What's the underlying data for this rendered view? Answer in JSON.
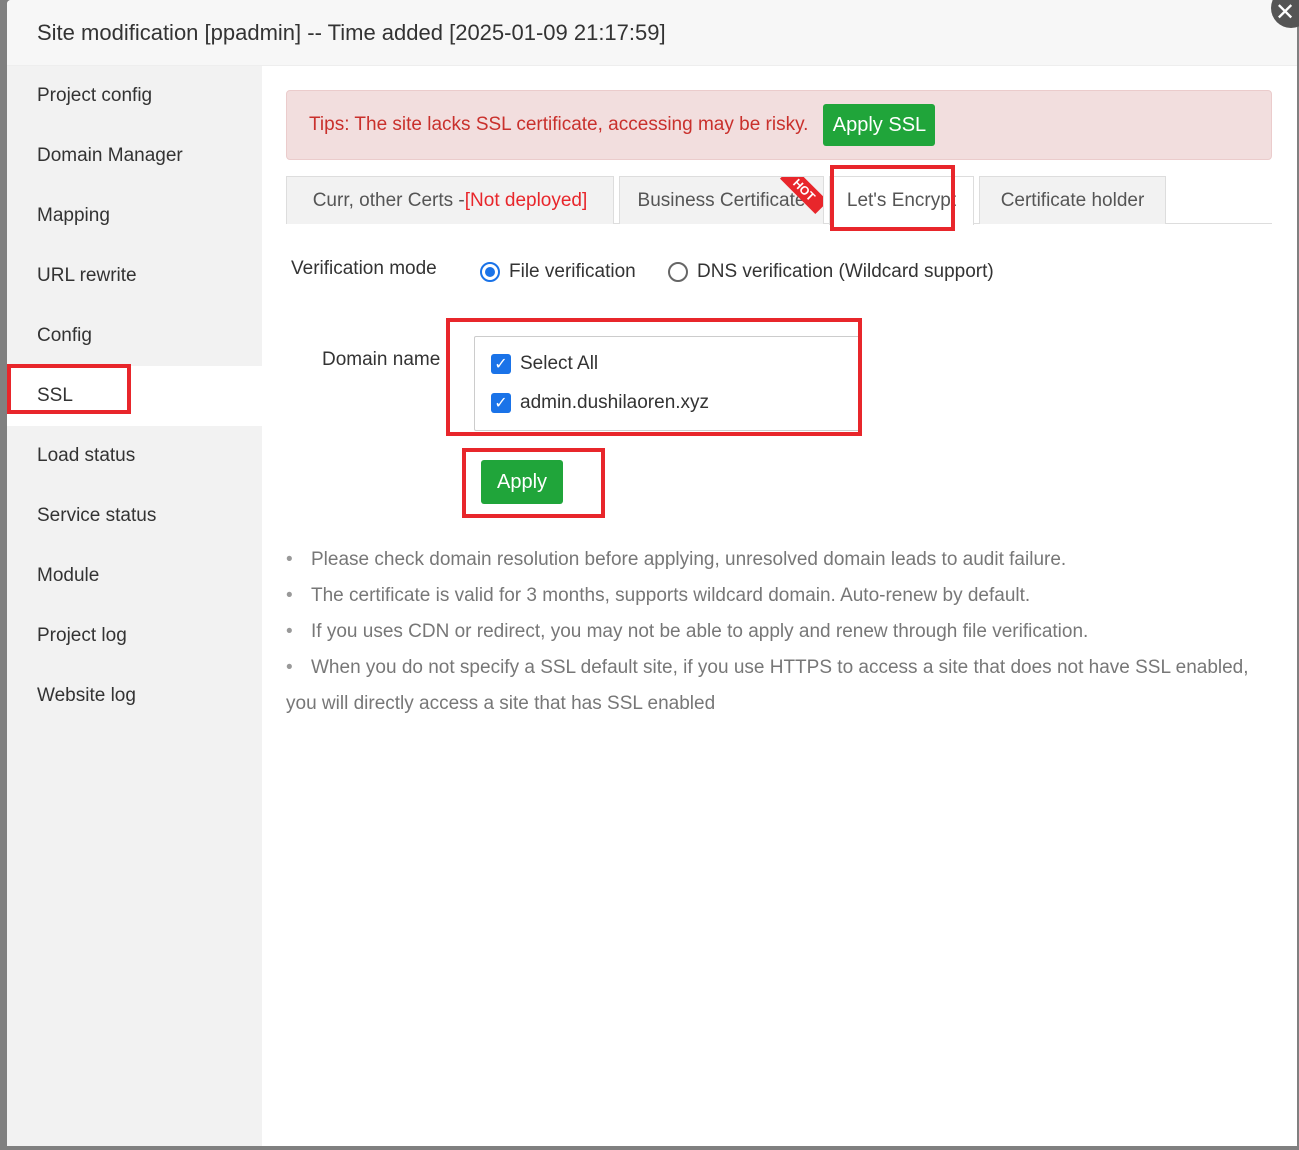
{
  "dialog": {
    "title": "Site modification [ppadmin] -- Time added [2025-01-09 21:17:59]",
    "close_icon": "✕"
  },
  "sidebar": {
    "items": [
      {
        "label": "Project config"
      },
      {
        "label": "Domain Manager"
      },
      {
        "label": "Mapping"
      },
      {
        "label": "URL rewrite"
      },
      {
        "label": "Config"
      },
      {
        "label": "SSL",
        "active": true
      },
      {
        "label": "Load status"
      },
      {
        "label": "Service status"
      },
      {
        "label": "Module"
      },
      {
        "label": "Project log"
      },
      {
        "label": "Website log"
      }
    ]
  },
  "tips": {
    "text": "Tips: The site lacks SSL certificate, accessing may be risky.",
    "button_label": "Apply SSL"
  },
  "tabs": {
    "curr": {
      "label": "Curr, other Certs - ",
      "status": "[Not deployed]"
    },
    "business": {
      "label": "Business Certificate",
      "badge": "HOT"
    },
    "letsencrypt": {
      "label": "Let's Encrypt"
    },
    "holder": {
      "label": "Certificate holder"
    }
  },
  "verification": {
    "label": "Verification mode",
    "options": [
      {
        "label": "File verification",
        "selected": true
      },
      {
        "label": "DNS verification (Wildcard support)",
        "selected": false
      }
    ]
  },
  "domain": {
    "label": "Domain name",
    "select_all_label": "Select All",
    "items": [
      {
        "label": "admin.dushilaoren.xyz",
        "checked": true
      }
    ]
  },
  "apply_button": "Apply",
  "notes": [
    "Please check domain resolution before applying, unresolved domain leads to audit failure.",
    "The certificate is valid for 3 months, supports wildcard domain. Auto-renew by default.",
    "If you uses CDN or redirect, you may not be able to apply and renew through file verification.",
    "When you do not specify a SSL default site, if you use HTTPS to access a site that does not have SSL enabled,"
  ],
  "notes_wrap": "you will directly access a site that has SSL enabled",
  "colors": {
    "accent_green": "#20a53a",
    "highlight_red": "#e8262b",
    "tip_text": "#c9302c",
    "tip_bg": "#f2dede"
  }
}
